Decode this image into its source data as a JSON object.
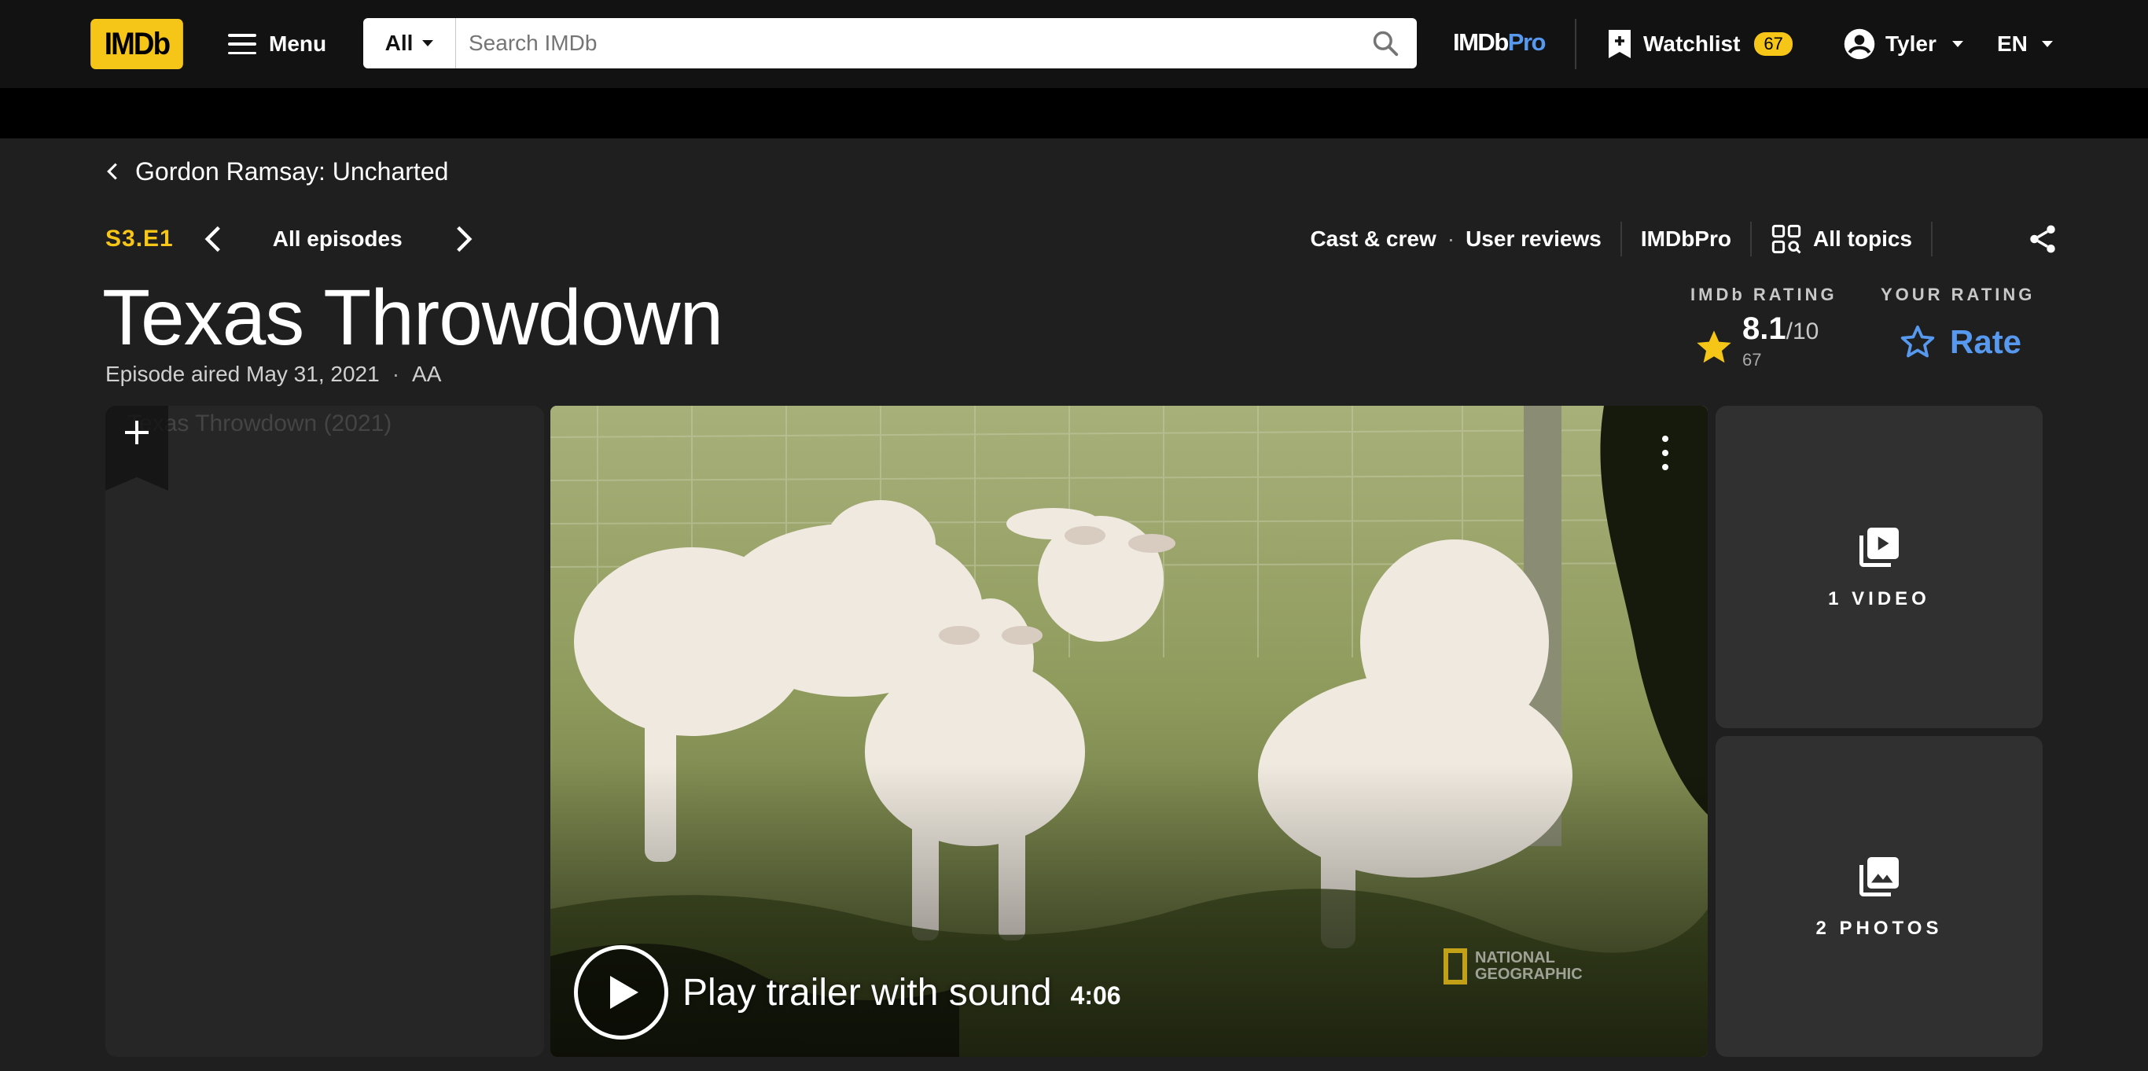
{
  "nav": {
    "logo": "IMDb",
    "menu_label": "Menu",
    "search_category": "All",
    "search_placeholder": "Search IMDb",
    "imdbpro_a": "IMDb",
    "imdbpro_b": "Pro",
    "watchlist_label": "Watchlist",
    "watchlist_count": "67",
    "user_name": "Tyler",
    "language": "EN"
  },
  "breadcrumb": {
    "series_title": "Gordon Ramsay: Uncharted"
  },
  "episode": {
    "code": "S3.E1",
    "all_episodes_label": "All episodes",
    "title": "Texas Throwdown",
    "aired": "Episode aired May 31, 2021",
    "certificate": "AA"
  },
  "links": {
    "cast_crew": "Cast & crew",
    "user_reviews": "User reviews",
    "imdbpro": "IMDbPro",
    "all_topics": "All topics"
  },
  "rating": {
    "imdb_label": "IMDb RATING",
    "value": "8.1",
    "out_of": "/10",
    "votes": "67",
    "your_label": "YOUR RATING",
    "rate_label": "Rate"
  },
  "media": {
    "poster_alt": "Texas Throwdown (2021)",
    "play_label": "Play trailer with sound",
    "duration": "4:06",
    "watermark_line1": "NATIONAL",
    "watermark_line2": "GEOGRAPHIC",
    "videos_label": "1 VIDEO",
    "photos_label": "2 PHOTOS"
  },
  "colors": {
    "imdb_yellow": "#f5c518",
    "link_blue": "#5799ef",
    "page_bg": "#1f1f1f",
    "nav_bg": "#121212"
  },
  "icons": [
    "hamburger-icon",
    "chevron-down-icon",
    "search-icon",
    "watchlist-add-icon",
    "account-circle-icon",
    "chevron-left-icon",
    "chevron-right-icon",
    "topics-grid-icon",
    "share-icon",
    "star-icon",
    "star-outline-icon",
    "plus-icon",
    "more-vert-icon",
    "play-icon",
    "video-library-icon",
    "photo-library-icon"
  ]
}
